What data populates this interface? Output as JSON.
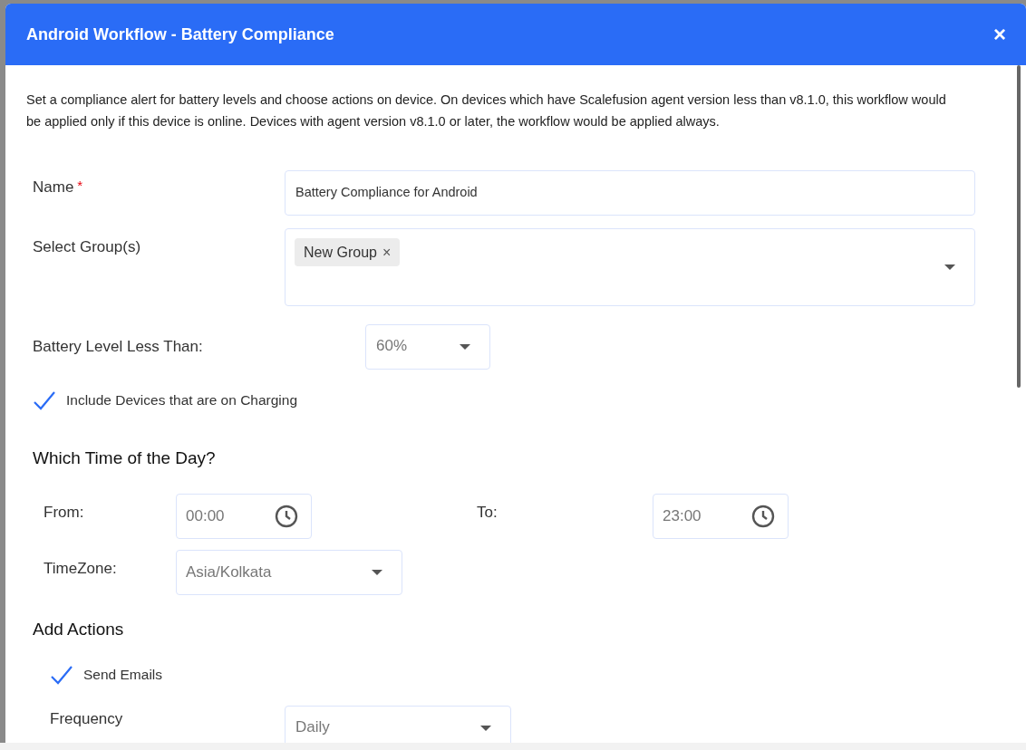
{
  "dialog": {
    "title": "Android Workflow - Battery Compliance",
    "close": "×",
    "description": "Set a compliance alert for battery levels and choose actions on device. On devices which have Scalefusion agent version less than v8.1.0, this workflow would be applied only if this device is online. Devices with agent version v8.1.0 or later, the workflow would be applied always.",
    "name_field": {
      "label": "Name",
      "required_mark": "*",
      "value": "Battery Compliance for Android"
    },
    "group_field": {
      "label": "Select Group(s)",
      "tags": [
        {
          "label": "New Group",
          "remove": "×"
        }
      ]
    },
    "battery_field": {
      "label": "Battery Level Less Than:",
      "value": "60%"
    },
    "include_charging": {
      "label": "Include Devices that are on Charging",
      "checked": true
    },
    "time_section": {
      "heading": "Which Time of the Day?",
      "from": {
        "label": "From:",
        "value": "00:00"
      },
      "to": {
        "label": "To:",
        "value": "23:00"
      },
      "timezone": {
        "label": "TimeZone:",
        "value": "Asia/Kolkata"
      }
    },
    "actions_section": {
      "heading": "Add Actions",
      "send_emails": {
        "label": "Send Emails",
        "checked": true
      },
      "frequency": {
        "label": "Frequency",
        "value": "Daily"
      }
    }
  }
}
